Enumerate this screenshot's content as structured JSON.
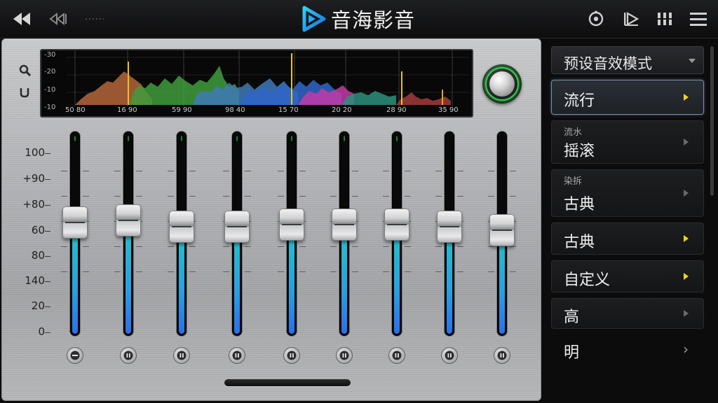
{
  "app": {
    "title": "音海影音"
  },
  "spectrum": {
    "y_labels": [
      "-30",
      "-20",
      "-10",
      "-10"
    ],
    "x_labels": [
      "50 80",
      "16 90",
      "59 90",
      "98 40",
      "15 70",
      "20 20",
      "28 90",
      "35 90"
    ]
  },
  "scale": {
    "labels": [
      "100",
      "+90",
      "+80",
      "60",
      "80",
      "140",
      "20",
      "0"
    ]
  },
  "bands": [
    {
      "level": 0.55,
      "led": "∥",
      "button": "minus"
    },
    {
      "level": 0.56,
      "led": "∥",
      "button": "pause"
    },
    {
      "level": 0.53,
      "led": "∥",
      "button": "pause"
    },
    {
      "level": 0.53,
      "led": "∥",
      "button": "pause"
    },
    {
      "level": 0.54,
      "led": "∥",
      "button": "pause"
    },
    {
      "level": 0.54,
      "led": "∥",
      "button": "pause"
    },
    {
      "level": 0.54,
      "led": "∥",
      "button": "pause"
    },
    {
      "level": 0.53,
      "led": "",
      "button": "pause"
    },
    {
      "level": 0.51,
      "led": "",
      "button": "pause"
    }
  ],
  "presets": {
    "header": "预设音效模式",
    "items": [
      {
        "sub": "",
        "label": "流行",
        "active": true,
        "marker": "yellow"
      },
      {
        "sub": "流水",
        "label": "摇滚",
        "active": false,
        "marker": "gray"
      },
      {
        "sub": "染拆",
        "label": "古典",
        "active": false,
        "marker": "gray"
      },
      {
        "sub": "",
        "label": "古典",
        "active": false,
        "marker": "yellow"
      },
      {
        "sub": "",
        "label": "自定义",
        "active": false,
        "marker": "yellow"
      },
      {
        "sub": "",
        "label": "高",
        "active": false,
        "marker": "gray"
      },
      {
        "sub": "",
        "label": "明",
        "active": false,
        "marker": "chevron"
      }
    ]
  },
  "colors": {
    "accent_yellow": "#f1d21c",
    "power_green": "#2fcf4a",
    "fill_cyan": "#25c2c6",
    "fill_blue": "#2b6fe8"
  },
  "icons": {
    "top_left": [
      "rewind-icon",
      "step-back-icon"
    ],
    "top_right": [
      "timer-icon",
      "play-screen-icon",
      "grid-icon",
      "menu-icon"
    ],
    "side": [
      "search-icon",
      "reset-icon"
    ]
  }
}
